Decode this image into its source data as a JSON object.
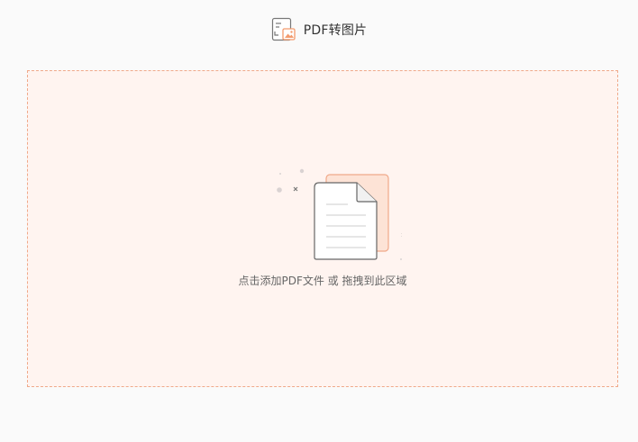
{
  "header": {
    "title": "PDF转图片",
    "icon": "pdf-to-image-icon"
  },
  "dropzone": {
    "hint": "点击添加PDF文件 或 拖拽到此区域",
    "illustration": "document-stack-icon"
  },
  "colors": {
    "dropzone_border": "#f0a98a",
    "dropzone_background": "#fff4f0",
    "accent": "#f39b6e"
  }
}
